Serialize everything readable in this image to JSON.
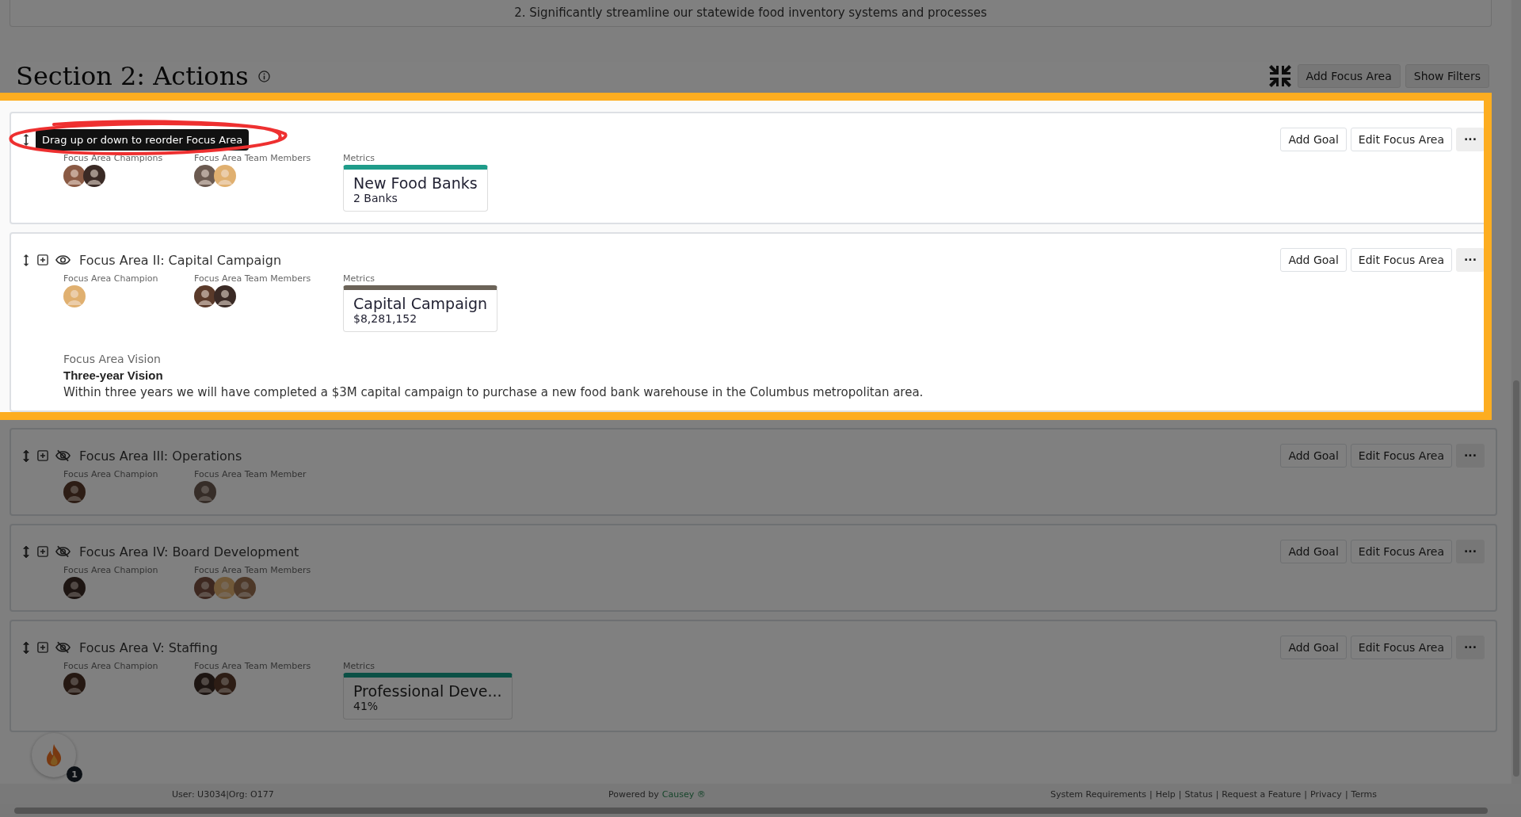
{
  "goal_text": "2. Significantly streamline our statewide food inventory systems and processes",
  "section": {
    "title": "Section 2: Actions",
    "buttons": [
      "Add Focus Area",
      "Show Filters"
    ]
  },
  "focus_areas": [
    {
      "highlighted": true,
      "tooltip": "Drag up or down to reorder Focus Area",
      "champions_label": "Focus Area Champions",
      "champions": [
        {
          "color": "#8a5a44"
        },
        {
          "color": "#3a2a25"
        }
      ],
      "team_label": "Focus Area Team Members",
      "team": [
        {
          "color": "#6b5a50"
        },
        {
          "color": "#e0b070"
        }
      ],
      "metrics_label": "Metrics",
      "metric": {
        "title": "New Food Banks",
        "value": "2 Banks",
        "color": "#1f9c8a"
      },
      "buttons": [
        "Add Goal",
        "Edit Focus Area",
        "···"
      ]
    },
    {
      "highlighted": true,
      "visible": true,
      "title": "Focus Area II: Capital Campaign",
      "champions_label": "Focus Area Champion",
      "champions": [
        {
          "color": "#e0b070"
        }
      ],
      "team_label": "Focus Area Team Members",
      "team": [
        {
          "color": "#5a3a2a"
        },
        {
          "color": "#3a2a25"
        }
      ],
      "metrics_label": "Metrics",
      "metric": {
        "title": "Capital Campaign",
        "value": "$8,281,152",
        "color": "#6b6358"
      },
      "vision": {
        "label": "Focus Area Vision",
        "title": "Three-year Vision",
        "text": "Within three years we will have completed a $3M capital campaign to purchase a new food bank warehouse in the Columbus metropolitan area."
      },
      "buttons": [
        "Add Goal",
        "Edit Focus Area",
        "···"
      ]
    },
    {
      "highlighted": false,
      "visible": false,
      "title": "Focus Area III: Operations",
      "champions_label": "Focus Area Champion",
      "champions": [
        {
          "color": "#2d1d15"
        }
      ],
      "team_label": "Focus Area Team Member",
      "team": [
        {
          "color": "#362d28"
        }
      ],
      "buttons": [
        "Add Goal",
        "Edit Focus Area",
        "···"
      ]
    },
    {
      "highlighted": false,
      "visible": false,
      "title": "Focus Area IV: Board Development",
      "champions_label": "Focus Area Champion",
      "champions": [
        {
          "color": "#1d1512"
        }
      ],
      "team_label": "Focus Area Team Members",
      "team": [
        {
          "color": "#3d2820"
        },
        {
          "color": "#705838"
        },
        {
          "color": "#4d3828"
        }
      ],
      "buttons": [
        "Add Goal",
        "Edit Focus Area",
        "···"
      ]
    },
    {
      "highlighted": false,
      "visible": false,
      "title": "Focus Area V: Staffing",
      "champions_label": "Focus Area Champion",
      "champions": [
        {
          "color": "#251812"
        }
      ],
      "team_label": "Focus Area Team Members",
      "team": [
        {
          "color": "#1d1512"
        },
        {
          "color": "#2d1d15"
        }
      ],
      "metrics_label": "Metrics",
      "metric": {
        "title": "Professional Deve...",
        "value": "41%",
        "color": "#0b5045"
      },
      "buttons": [
        "Add Goal",
        "Edit Focus Area",
        "···"
      ]
    }
  ],
  "notification": {
    "badge": "1"
  },
  "footer": {
    "user": "User: U3034|Org: O177",
    "powered_by": "Powered by",
    "brand": "Causey ®",
    "links": [
      "System Requirements",
      "Help",
      "Status",
      "Request a Feature",
      "Privacy",
      "Terms"
    ],
    "separator": "|"
  }
}
